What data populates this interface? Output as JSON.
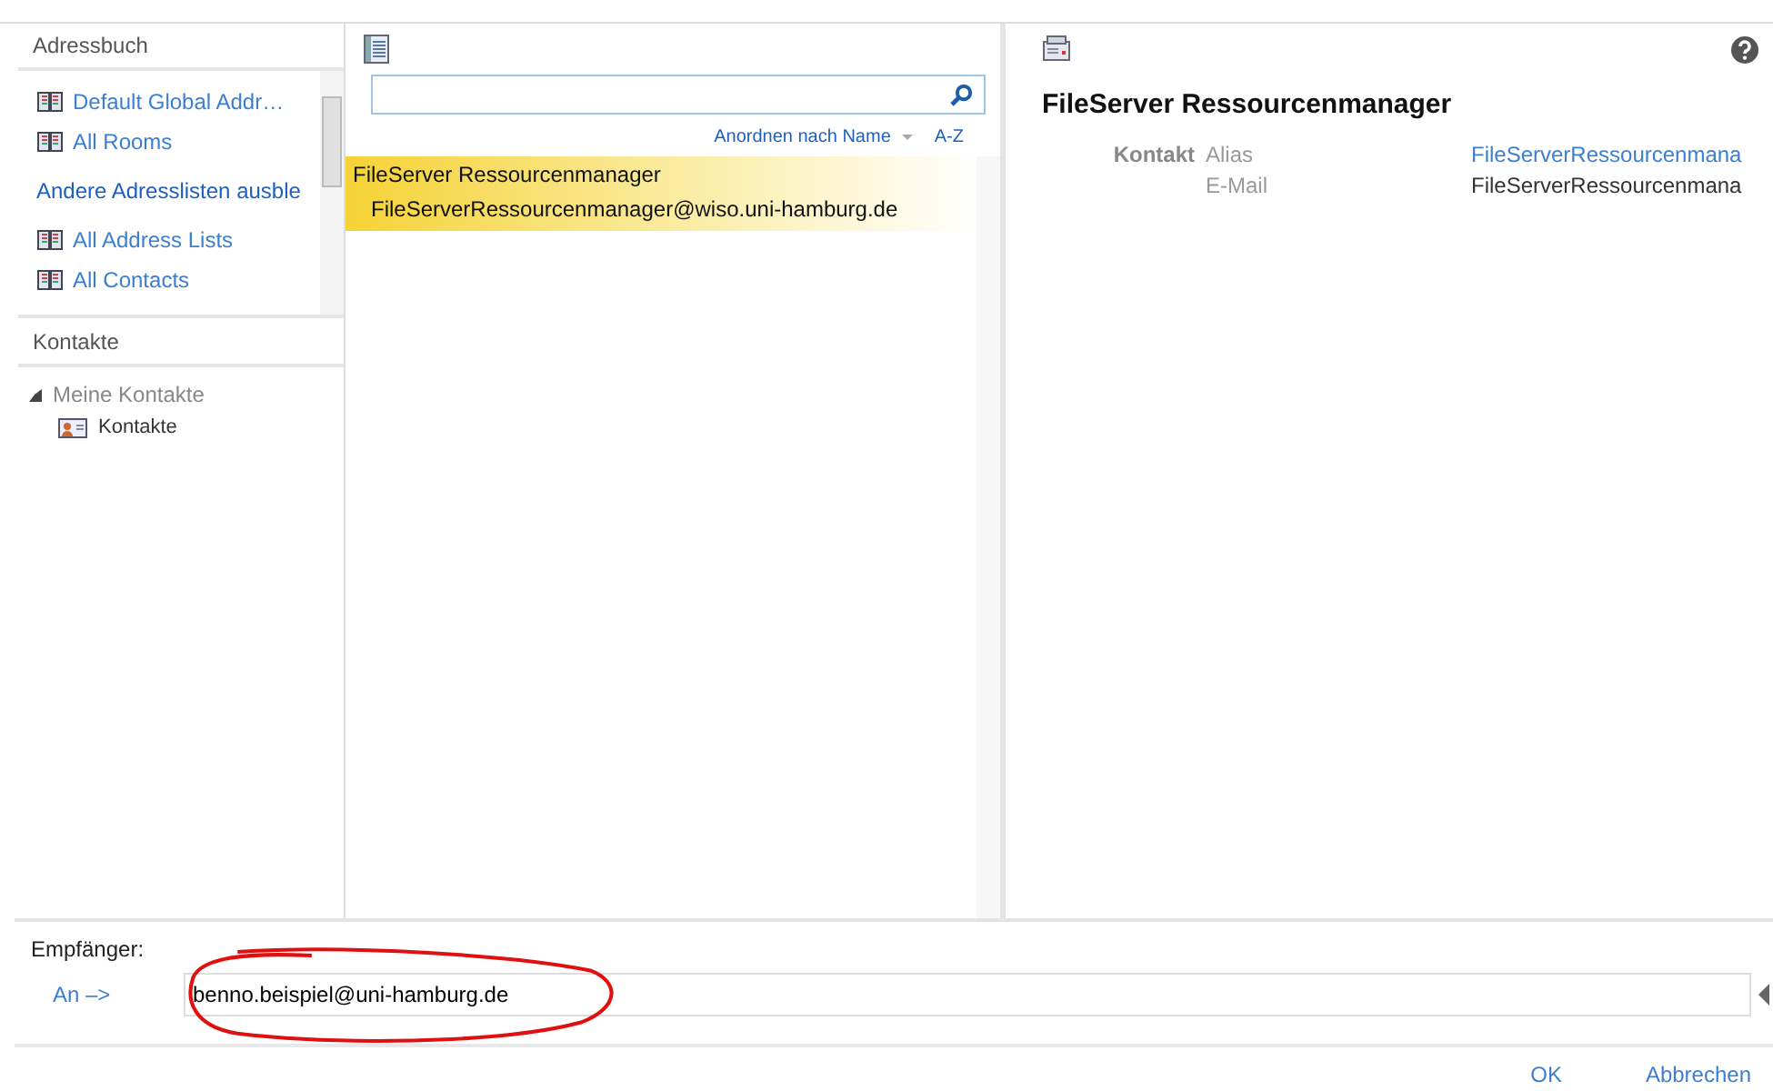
{
  "address_book": {
    "title": "Adressbuch",
    "items": [
      {
        "kind": "list",
        "label": "Default Global Addr…"
      },
      {
        "kind": "list",
        "label": "All Rooms"
      },
      {
        "kind": "link",
        "label": "Andere Adresslisten ausble"
      },
      {
        "kind": "list",
        "label": "All Address Lists"
      },
      {
        "kind": "list",
        "label": "All Contacts"
      }
    ]
  },
  "contacts": {
    "title": "Kontakte",
    "tree": [
      {
        "label": "Meine Kontakte",
        "expanded": true,
        "children": [
          {
            "label": "Kontakte"
          }
        ]
      }
    ]
  },
  "results": {
    "sort": "Anordnen nach Name",
    "order": "A-Z",
    "rows": [
      {
        "name": "FileServer Ressourcenmanager",
        "email": "FileServerRessourcenmanager@wiso.uni-hamburg.de",
        "selected": true
      }
    ]
  },
  "detail": {
    "title": "FileServer Ressourcenmanager",
    "section": "Kontakt",
    "fields": [
      {
        "label": "Alias",
        "value": "FileServerRessourcenmana",
        "kind": "link"
      },
      {
        "label": "E-Mail",
        "value": "FileServerRessourcenmana",
        "kind": "text"
      }
    ]
  },
  "recipients": {
    "label": "Empfänger:",
    "to_button": "An –>",
    "value": "benno.beispiel@uni-hamburg.de"
  },
  "buttons": [
    "OK",
    "Abbrechen"
  ]
}
